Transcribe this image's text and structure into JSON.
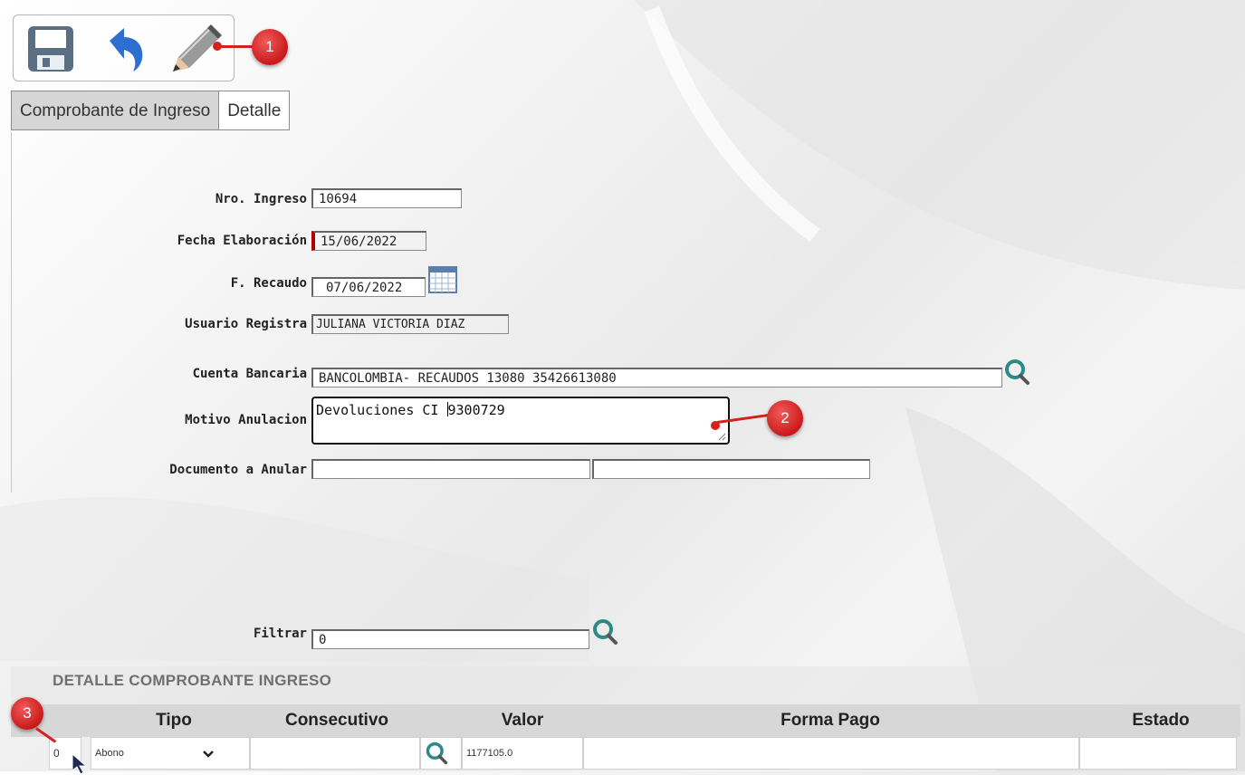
{
  "toolbar": {
    "save_icon": "save-icon",
    "undo_icon": "undo-icon",
    "edit_icon": "pencil-icon"
  },
  "tabs": [
    {
      "label": "Comprobante de Ingreso",
      "active": true
    },
    {
      "label": "Detalle",
      "active": false
    }
  ],
  "form": {
    "nro_ingreso": {
      "label": "Nro. Ingreso",
      "value": "10694"
    },
    "fecha_elaboracion": {
      "label": "Fecha Elaboración",
      "value": "15/06/2022"
    },
    "f_recaudo": {
      "label": "F. Recaudo",
      "value": "07/06/2022"
    },
    "usuario_registra": {
      "label": "Usuario Registra",
      "value": "JULIANA VICTORIA DIAZ"
    },
    "cuenta_bancaria": {
      "label": "Cuenta Bancaria",
      "value": "BANCOLOMBIA- RECAUDOS 13080 35426613080"
    },
    "motivo_anulacion": {
      "label": "Motivo Anulacion",
      "value_before_caret": "Devoluciones CI ",
      "value_after_caret": "9300729"
    },
    "documento_anular": {
      "label": "Documento a Anular",
      "value1": "",
      "value2": ""
    },
    "filtrar": {
      "label": "Filtrar",
      "value": "0"
    }
  },
  "callouts": [
    "1",
    "2",
    "3"
  ],
  "detail": {
    "title": "DETALLE COMPROBANTE INGRESO",
    "columns": [
      "Tipo",
      "Consecutivo",
      "Valor",
      "Forma Pago",
      "Estado"
    ],
    "rows": [
      {
        "index": "0",
        "tipo": "Abono",
        "consecutivo": "",
        "valor": "1177105.0",
        "forma_pago": "",
        "estado": ""
      }
    ]
  },
  "colors": {
    "accent_red": "#d32020",
    "header_gray": "#d7d7d7",
    "required_marker": "#b00000"
  }
}
